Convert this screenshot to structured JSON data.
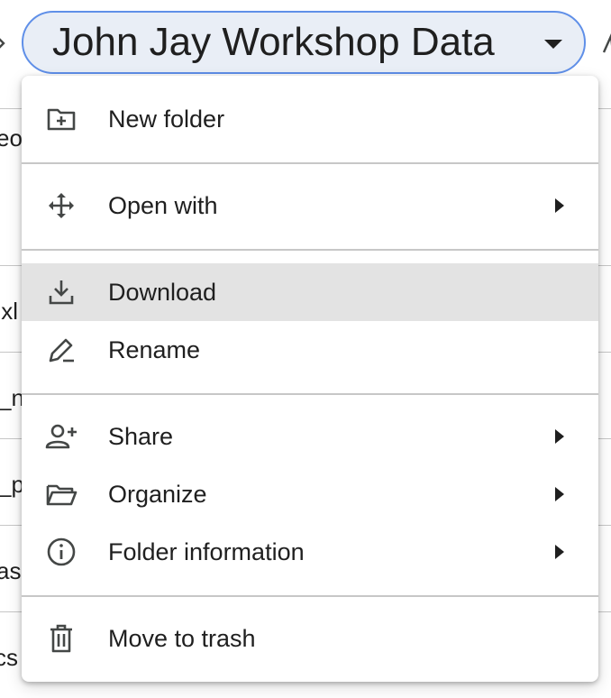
{
  "breadcrumb": {
    "folder_title": "John Jay Workshop Data"
  },
  "background_list": {
    "fragments": [
      "eo",
      ".xl",
      "_n",
      "_p",
      "as",
      "cs"
    ]
  },
  "context_menu": {
    "items": [
      {
        "label": "New folder",
        "icon": "new-folder-icon",
        "has_submenu": false
      },
      {
        "label": "Open with",
        "icon": "open-with-move-icon",
        "has_submenu": true
      },
      {
        "label": "Download",
        "icon": "download-icon",
        "has_submenu": false,
        "highlighted": true
      },
      {
        "label": "Rename",
        "icon": "rename-pencil-icon",
        "has_submenu": false
      },
      {
        "label": "Share",
        "icon": "share-person-add-icon",
        "has_submenu": true
      },
      {
        "label": "Organize",
        "icon": "organize-folder-open-icon",
        "has_submenu": true
      },
      {
        "label": "Folder information",
        "icon": "info-icon",
        "has_submenu": true
      },
      {
        "label": "Move to trash",
        "icon": "trash-icon",
        "has_submenu": false
      }
    ]
  },
  "colors": {
    "pill_background": "#e9eef6",
    "pill_border": "#5f8fe8",
    "hover_background": "#e3e3e3",
    "icon_color": "#444746",
    "text_color": "#1f1f1f"
  }
}
